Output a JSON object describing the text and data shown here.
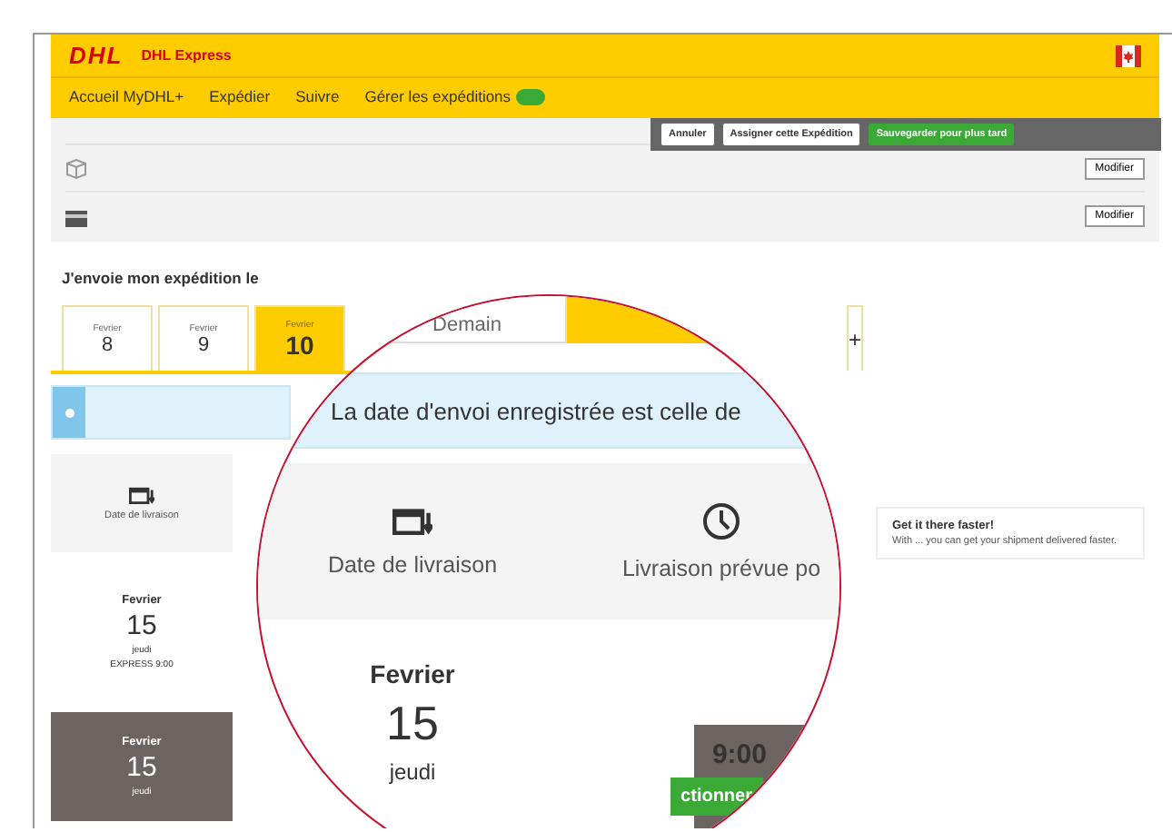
{
  "header": {
    "logo": "DHL",
    "product": "DHL Express"
  },
  "nav": {
    "items": [
      {
        "label": "Accueil MyDHL+",
        "selected": false
      },
      {
        "label": "Expédier",
        "selected": false
      },
      {
        "label": "Suivre",
        "selected": false
      },
      {
        "label": "Gérer les expéditions",
        "selected": false
      }
    ]
  },
  "actions": [
    {
      "label": "Annuler",
      "kind": "cancel"
    },
    {
      "label": "Assigner cette Expédition",
      "kind": "assign"
    },
    {
      "label": "Sauvegarder pour plus tard",
      "kind": "save"
    }
  ],
  "summary_rows": [
    {
      "kind": "package",
      "action": "Modifier"
    },
    {
      "kind": "payment",
      "action": "Modifier"
    }
  ],
  "date_section": {
    "title": "J'envoie mon expédition le",
    "dates": [
      {
        "month": "Fevrier",
        "day": "8",
        "selected": false
      },
      {
        "month": "Fevrier",
        "day": "9",
        "selected": false
      },
      {
        "month": "Fevrier",
        "day": "10",
        "selected": true
      }
    ],
    "more": "+"
  },
  "table": {
    "column": "Date de livraison",
    "rows": [
      {
        "month": "Fevrier",
        "day": "15",
        "weekday": "jeudi",
        "service": "EXPRESS 9:00",
        "selected": false
      },
      {
        "month": "Fevrier",
        "day": "15",
        "weekday": "jeudi",
        "selected": true
      }
    ]
  },
  "magnifier": {
    "tab": "Demain",
    "info": "La date d'envoi enregistrée est celle de",
    "columns": [
      {
        "kind": "calendar",
        "label": "Date de livraison"
      },
      {
        "kind": "clock",
        "label": "Livraison prévue po"
      }
    ],
    "row": {
      "month": "Fevrier",
      "day": "15",
      "weekday": "jeudi",
      "time": "9:00",
      "button": "ctionner"
    }
  },
  "promo": {
    "title": "Get it there faster!",
    "text": "With ... you can get your shipment delivered faster."
  }
}
